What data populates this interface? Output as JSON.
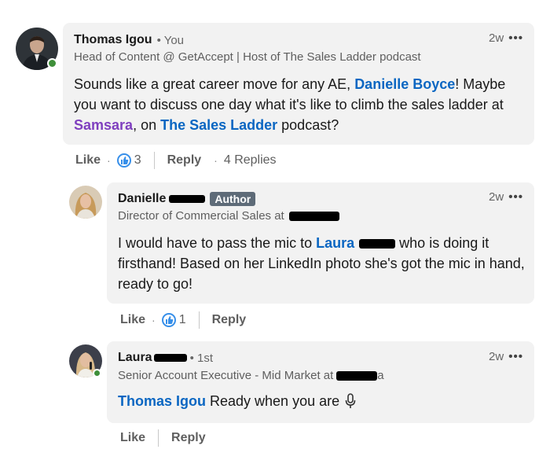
{
  "comments": [
    {
      "author": "Thomas Igou",
      "relation": "• You",
      "headline": "Head of Content @ GetAccept | Host of The Sales Ladder podcast",
      "time": "2w",
      "more": "•••",
      "body": {
        "t1": "Sounds like a great career move for any AE, ",
        "m1": "Danielle Boyce",
        "t2": "! Maybe you want to discuss one day what it's like to climb the sales ladder at ",
        "m2": "Samsara",
        "t3": ", on ",
        "m3": "The Sales Ladder",
        "t4": " podcast?"
      },
      "actions": {
        "like": "Like",
        "sep": "·",
        "like_count": "3",
        "reply": "Reply",
        "replies": "4 Replies"
      },
      "online": true
    },
    {
      "author": "Danielle",
      "badge": "Author",
      "headline": "Director of Commercial Sales at",
      "time": "2w",
      "more": "•••",
      "body": {
        "t1": "I would have to pass the mic to ",
        "m1": "Laura",
        "t2": " who is doing it firsthand! Based on her LinkedIn photo she's got the mic in hand, ready to go!"
      },
      "actions": {
        "like": "Like",
        "sep": "·",
        "like_count": "1",
        "reply": "Reply"
      }
    },
    {
      "author": "Laura",
      "relation": "• 1st",
      "headline": "Senior Account Executive - Mid Market at",
      "headline_tail": "a",
      "time": "2w",
      "more": "•••",
      "body": {
        "m1": "Thomas Igou",
        "t1": " Ready when you are ",
        "emoji_icon": "microphone-icon"
      },
      "actions": {
        "like": "Like",
        "reply": "Reply"
      },
      "online": true
    }
  ],
  "colors": {
    "bubble": "#f2f2f2",
    "mention": "#0a66c2",
    "company_mention": "#7f3fbf",
    "online": "#3f8f3a",
    "author_badge": "#5e6b78"
  }
}
